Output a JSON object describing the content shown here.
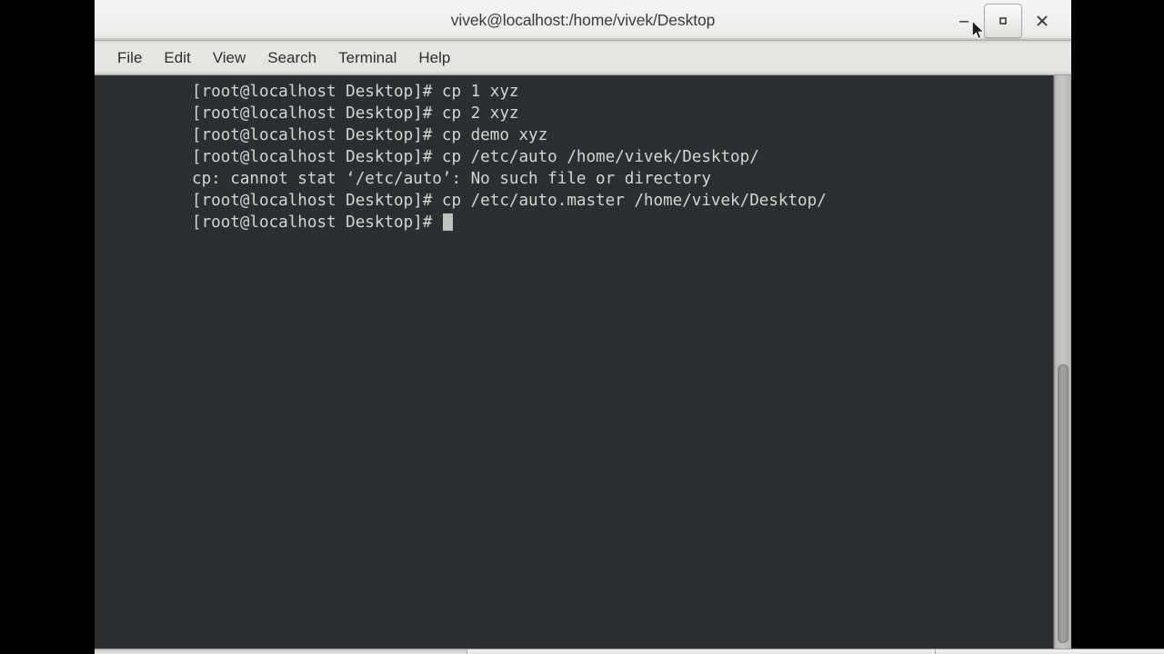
{
  "window": {
    "title": "vivek@localhost:/home/vivek/Desktop",
    "controls": {
      "minimize_label": "Minimize",
      "maximize_label": "Maximize",
      "close_label": "Close"
    }
  },
  "menubar": {
    "items": [
      {
        "label": "File"
      },
      {
        "label": "Edit"
      },
      {
        "label": "View"
      },
      {
        "label": "Search"
      },
      {
        "label": "Terminal"
      },
      {
        "label": "Help"
      }
    ]
  },
  "terminal": {
    "prompt": "[root@localhost Desktop]# ",
    "lines": [
      {
        "text": "[root@localhost Desktop]# cp 1 xyz"
      },
      {
        "text": "[root@localhost Desktop]# cp 2 xyz"
      },
      {
        "text": "[root@localhost Desktop]# cp demo xyz"
      },
      {
        "text": "[root@localhost Desktop]# cp /etc/auto /home/vivek/Desktop/"
      },
      {
        "text": "cp: cannot stat ‘/etc/auto’: No such file or directory"
      },
      {
        "text": "[root@localhost Desktop]# cp /etc/auto.master /home/vivek/Desktop/"
      }
    ],
    "current_line": "[root@localhost Desktop]# ",
    "colors": {
      "background": "#2b2e33",
      "foreground": "#d3d7d1",
      "cursor": "#bfc3bd"
    }
  },
  "scrollbar": {
    "orientation": "vertical",
    "thumb_label": "scroll-thumb"
  },
  "panel": {
    "tasks": [
      {
        "label": ""
      },
      {
        "label": ""
      },
      {
        "label": ""
      }
    ]
  }
}
